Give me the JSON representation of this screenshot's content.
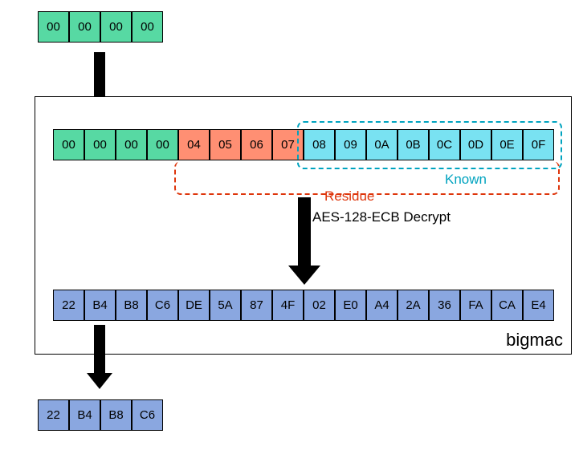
{
  "top_green": [
    "00",
    "00",
    "00",
    "00"
  ],
  "mid_row": {
    "green": [
      "00",
      "00",
      "00",
      "00"
    ],
    "red": [
      "04",
      "05",
      "06",
      "07"
    ],
    "teal": [
      "08",
      "09",
      "0A",
      "0B",
      "0C",
      "0D",
      "0E",
      "0F"
    ]
  },
  "output_row": [
    "22",
    "B4",
    "B8",
    "C6",
    "DE",
    "5A",
    "87",
    "4F",
    "02",
    "E0",
    "A4",
    "2A",
    "36",
    "FA",
    "CA",
    "E4"
  ],
  "bottom_blue": [
    "22",
    "B4",
    "B8",
    "C6"
  ],
  "labels": {
    "known": "Known",
    "residue": "Residue",
    "decrypt": "AES-128-ECB Decrypt",
    "bigmac": "bigmac"
  }
}
